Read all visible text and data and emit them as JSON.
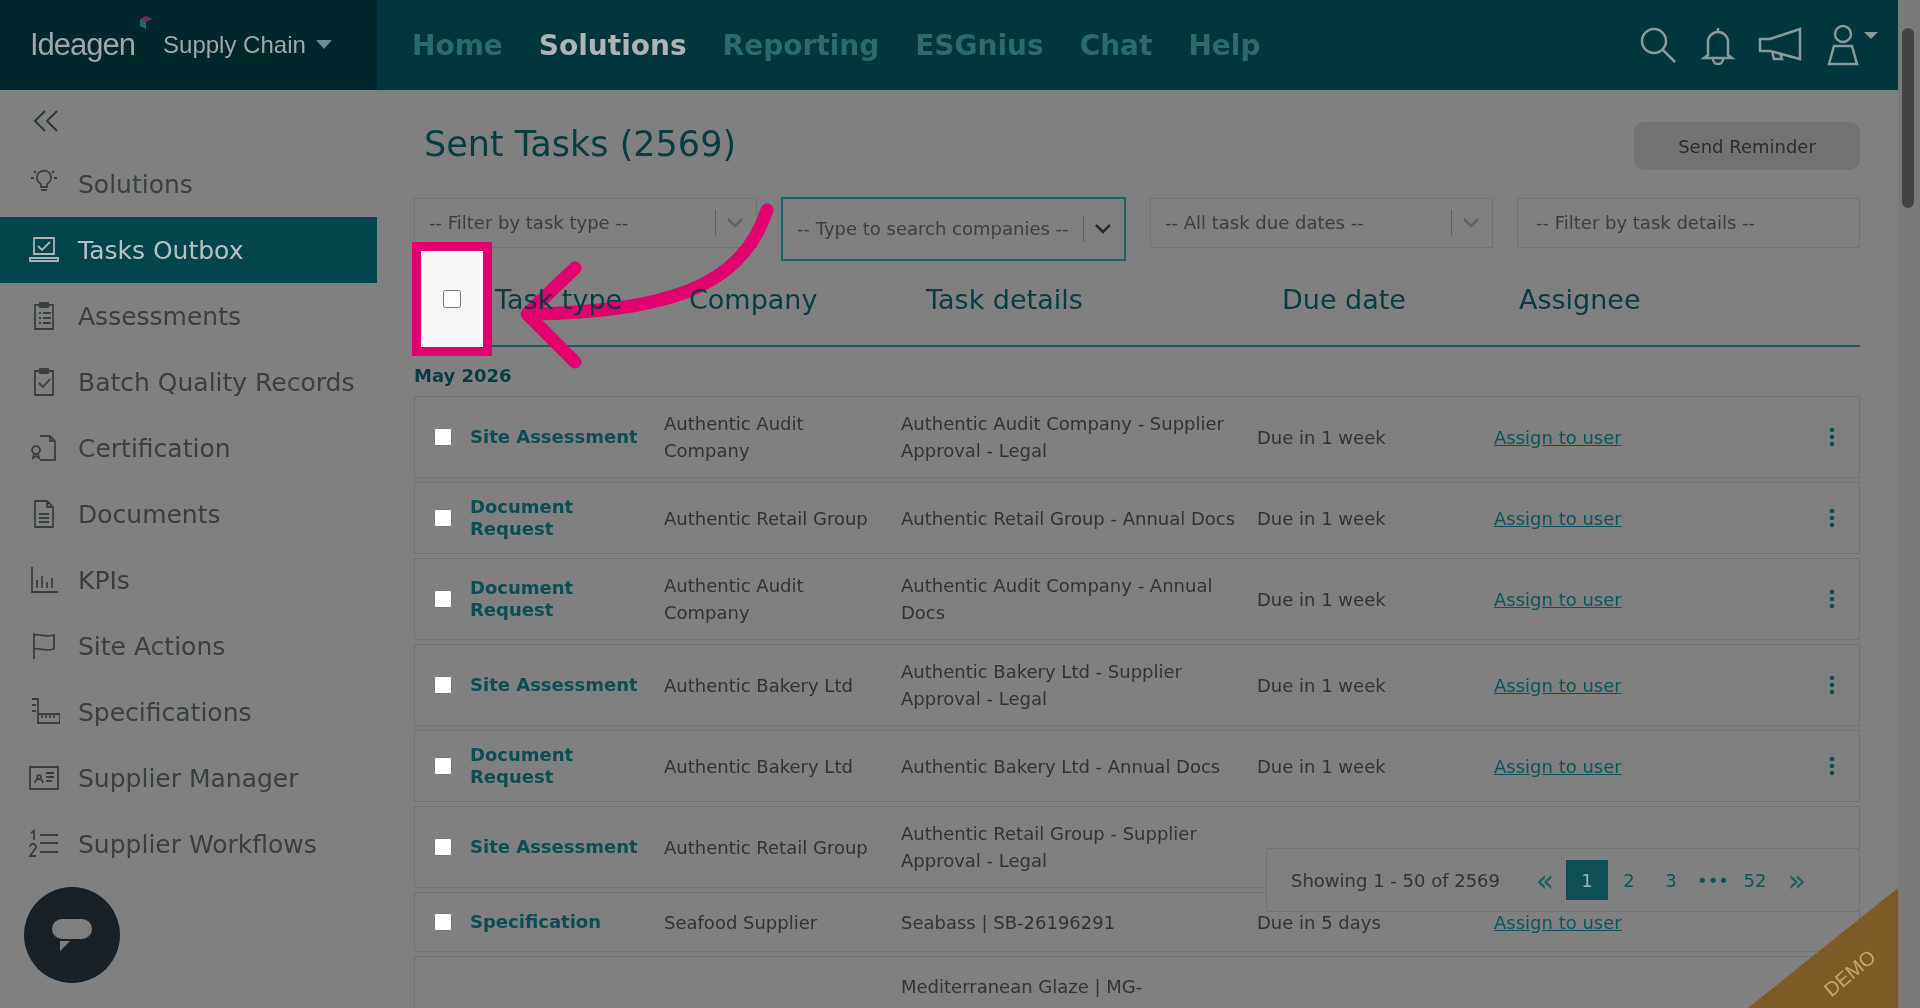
{
  "header": {
    "logo": "Ideagen",
    "product": "Supply Chain",
    "nav": [
      {
        "label": "Home",
        "selected": false
      },
      {
        "label": "Solutions",
        "selected": true
      },
      {
        "label": "Reporting",
        "selected": false
      },
      {
        "label": "ESGnius",
        "selected": false
      },
      {
        "label": "Chat",
        "selected": false
      },
      {
        "label": "Help",
        "selected": false
      }
    ]
  },
  "sidebar": {
    "items": [
      {
        "label": "Solutions",
        "selected": false
      },
      {
        "label": "Tasks Outbox",
        "selected": true
      },
      {
        "label": "Assessments",
        "selected": false
      },
      {
        "label": "Batch Quality Records",
        "selected": false
      },
      {
        "label": "Certification",
        "selected": false
      },
      {
        "label": "Documents",
        "selected": false
      },
      {
        "label": "KPIs",
        "selected": false
      },
      {
        "label": "Site Actions",
        "selected": false
      },
      {
        "label": "Specifications",
        "selected": false
      },
      {
        "label": "Supplier Manager",
        "selected": false
      },
      {
        "label": "Supplier Workflows",
        "selected": false
      }
    ]
  },
  "page": {
    "title": "Sent Tasks (2569)",
    "send_button": "Send Reminder"
  },
  "filters": [
    {
      "placeholder": "-- Filter by task type --",
      "kind": "select"
    },
    {
      "placeholder": "-- Type to search companies --",
      "kind": "search"
    },
    {
      "placeholder": "-- All task due dates --",
      "kind": "select"
    },
    {
      "placeholder": "-- Filter by task details --",
      "kind": "text"
    }
  ],
  "table": {
    "select_all_checked": false,
    "columns": [
      "Task type",
      "Company",
      "Task details",
      "Due date",
      "Assignee"
    ],
    "group": "May 2026",
    "rows": [
      {
        "checked": false,
        "task_type": "Site Assessment",
        "company": "Authentic Audit Company",
        "task_details": "Authentic Audit Company - Supplier Approval - Legal",
        "due_date": "Due in 1 week",
        "assignee": "Assign to user"
      },
      {
        "checked": false,
        "task_type": "Document Request",
        "company": "Authentic Retail Group",
        "task_details": "Authentic Retail Group - Annual Docs",
        "due_date": "Due in 1 week",
        "assignee": "Assign to user"
      },
      {
        "checked": false,
        "task_type": "Document Request",
        "company": "Authentic Audit Company",
        "task_details": "Authentic Audit Company - Annual Docs",
        "due_date": "Due in 1 week",
        "assignee": "Assign to user"
      },
      {
        "checked": false,
        "task_type": "Site Assessment",
        "company": "Authentic Bakery Ltd",
        "task_details": "Authentic Bakery Ltd - Supplier Approval - Legal",
        "due_date": "Due in 1 week",
        "assignee": "Assign to user"
      },
      {
        "checked": false,
        "task_type": "Document Request",
        "company": "Authentic Bakery Ltd",
        "task_details": "Authentic Bakery Ltd - Annual Docs",
        "due_date": "Due in 1 week",
        "assignee": "Assign to user"
      },
      {
        "checked": false,
        "task_type": "Site Assessment",
        "company": "Authentic Retail Group",
        "task_details": "Authentic Retail Group - Supplier Approval - Legal"
      },
      {
        "checked": false,
        "task_type": "Specification",
        "company": "Seafood Supplier",
        "task_details": "Seabass | SB-26196291",
        "due_date": "Due in 5 days",
        "assignee": "Assign to user"
      },
      {
        "task_details": "Mediterranean Glaze | MG-"
      }
    ]
  },
  "pagination": {
    "summary": "Showing 1 - 50 of 2569",
    "first": "«",
    "last": "»",
    "pages": [
      {
        "label": "1",
        "selected": true
      },
      {
        "label": "2",
        "selected": false
      },
      {
        "label": "3",
        "selected": false
      },
      {
        "label": "•••",
        "selected": false
      },
      {
        "label": "52",
        "selected": false
      }
    ]
  },
  "ribbon": "DEMO"
}
